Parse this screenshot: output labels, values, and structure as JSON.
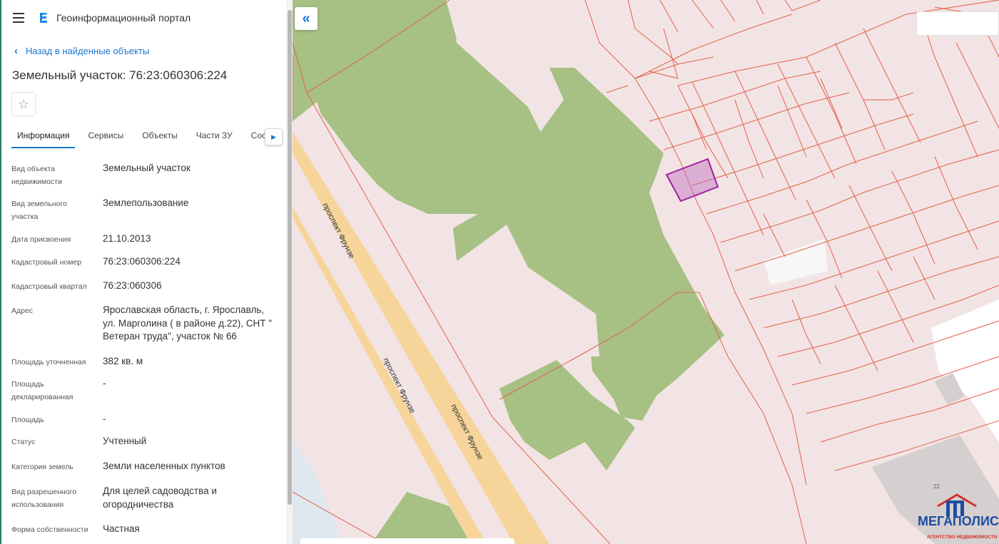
{
  "app": {
    "title": "Геоинформационный портал"
  },
  "nav": {
    "back_label": "Назад в найденные объекты"
  },
  "object": {
    "title": "Земельный участок: 76:23:060306:224"
  },
  "tabs": [
    {
      "label": "Информация",
      "active": true
    },
    {
      "label": "Сервисы",
      "active": false
    },
    {
      "label": "Объекты",
      "active": false
    },
    {
      "label": "Части ЗУ",
      "active": false
    },
    {
      "label": "Соста",
      "active": false
    }
  ],
  "properties": [
    {
      "label": "Вид объекта недвижимости",
      "value": "Земельный участок"
    },
    {
      "label": "Вид земельного участка",
      "value": "Землепользование"
    },
    {
      "label": "Дата присвоения",
      "value": "21.10.2013"
    },
    {
      "label": "Кадастровый номер",
      "value": "76:23:060306:224"
    },
    {
      "label": "Кадастровый квартал",
      "value": "76:23:060306"
    },
    {
      "label": "Адрес",
      "value": "Ярославская область, г. Ярославль, ул. Марголина ( в районе д.22), СНТ \" Ветеран труда\", участок № 66"
    },
    {
      "label": "Площадь уточненная",
      "value": "382 кв. м"
    },
    {
      "label": "Площадь декларированная",
      "value": "-"
    },
    {
      "label": "Площадь",
      "value": "-"
    },
    {
      "label": "Статус",
      "value": "Учтенный"
    },
    {
      "label": "Категория земель",
      "value": "Земли населенных пунктов"
    },
    {
      "label": "Вид разрешенного использования",
      "value": "Для целей садоводства и огородничества"
    },
    {
      "label": "Форма собственности",
      "value": "Частная"
    }
  ],
  "map": {
    "road_labels": [
      "проспект Фрунзе",
      "проспект Фрунзе",
      "проспект Фрунзе"
    ],
    "house_number": "22",
    "colors": {
      "parcel_fill": "#f2e4e4",
      "parcel_border": "#e4604a",
      "green_area": "#a7c084",
      "road": "#f6d49a",
      "selected": "#a020a0"
    }
  },
  "watermark": {
    "name": "МЕГАПОЛИС",
    "subtitle": "АГЕНТСТВО НЕДВИЖИМОСТИ"
  },
  "icons": [
    "menu-icon",
    "portal-logo-icon",
    "chevron-left-icon",
    "star-icon",
    "chevron-right-icon",
    "double-chevron-left-icon"
  ]
}
